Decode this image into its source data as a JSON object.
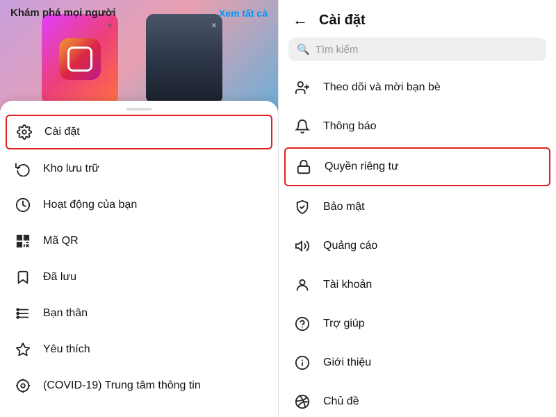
{
  "left": {
    "discover_title": "Khám phá mọi người",
    "discover_link": "Xem tất cả",
    "menu_items": [
      {
        "id": "settings",
        "icon": "⚙️",
        "label": "Cài đặt",
        "highlighted": true
      },
      {
        "id": "archive",
        "icon": "🕐",
        "label": "Kho lưu trữ"
      },
      {
        "id": "activity",
        "icon": "🕐",
        "label": "Hoạt động của bạn"
      },
      {
        "id": "qr",
        "icon": "⚏",
        "label": "Mã QR"
      },
      {
        "id": "saved",
        "icon": "🔖",
        "label": "Đã lưu"
      },
      {
        "id": "close-friends",
        "icon": "≔",
        "label": "Bạn thân"
      },
      {
        "id": "favorites",
        "icon": "☆",
        "label": "Yêu thích"
      },
      {
        "id": "covid",
        "icon": "◎",
        "label": "(COVID-19) Trung tâm thông tin"
      }
    ]
  },
  "right": {
    "back_label": "←",
    "title": "Cài đặt",
    "search_placeholder": "Tìm kiếm",
    "settings_items": [
      {
        "id": "follow",
        "icon": "+👤",
        "label": "Theo dõi và mời bạn bè"
      },
      {
        "id": "notifications",
        "icon": "🔔",
        "label": "Thông báo"
      },
      {
        "id": "privacy",
        "icon": "🔒",
        "label": "Quyền riêng tư",
        "highlighted": true
      },
      {
        "id": "security",
        "icon": "🛡",
        "label": "Bảo mật"
      },
      {
        "id": "ads",
        "icon": "📢",
        "label": "Quảng cáo"
      },
      {
        "id": "account",
        "icon": "👤",
        "label": "Tài khoản"
      },
      {
        "id": "help",
        "icon": "◎",
        "label": "Trợ giúp"
      },
      {
        "id": "about",
        "icon": "ℹ️",
        "label": "Giới thiệu"
      },
      {
        "id": "theme",
        "icon": "🎨",
        "label": "Chủ đề"
      }
    ]
  }
}
